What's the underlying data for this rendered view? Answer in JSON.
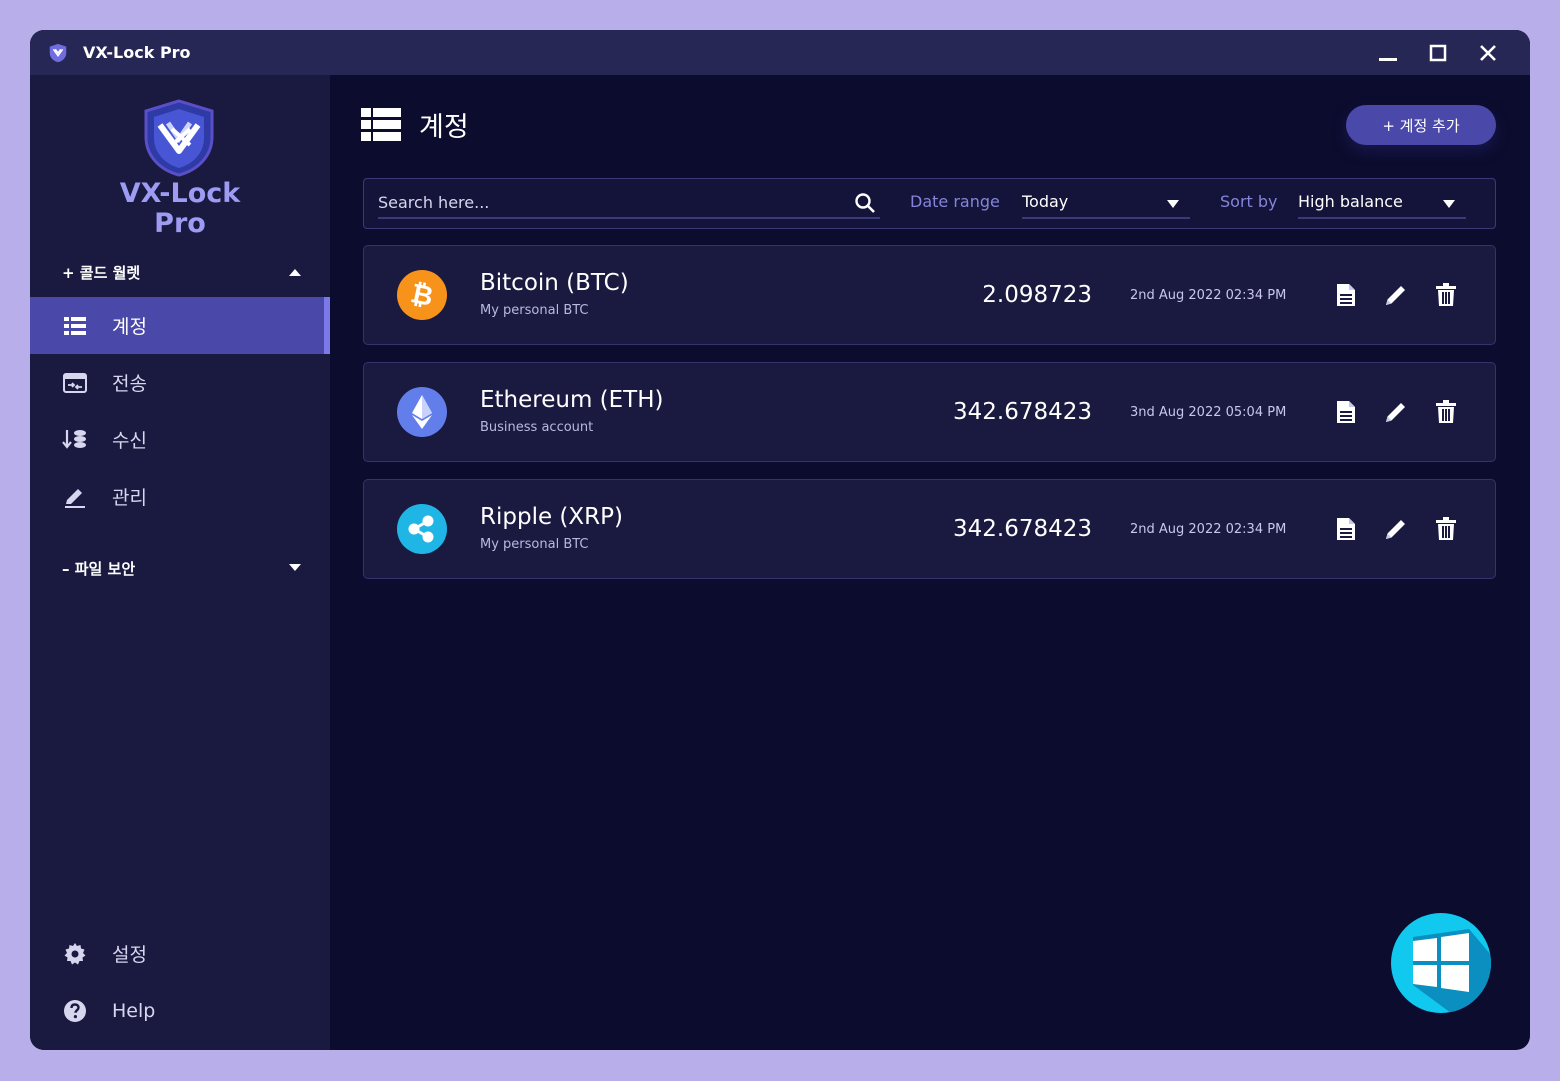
{
  "window": {
    "title": "VX-Lock Pro",
    "controls": {
      "minimize": "minimize-icon",
      "maximize": "maximize-icon",
      "close": "close-icon"
    }
  },
  "sidebar": {
    "brand_line1": "VX-Lock",
    "brand_line2": "Pro",
    "section_cold_wallet": {
      "label": "+ 콜드 월렛",
      "toggle": "caret-up-icon"
    },
    "items": [
      {
        "label": "계정",
        "icon": "list-icon",
        "active": true
      },
      {
        "label": "전송",
        "icon": "transfer-icon",
        "active": false
      },
      {
        "label": "수신",
        "icon": "receive-icon",
        "active": false
      },
      {
        "label": "관리",
        "icon": "edit-icon",
        "active": false
      }
    ],
    "section_file_security": {
      "label": "– 파일 보안",
      "toggle": "caret-down-icon"
    },
    "bottom_items": [
      {
        "label": "설정",
        "icon": "gear-icon"
      },
      {
        "label": "Help",
        "icon": "help-icon"
      }
    ]
  },
  "main": {
    "title": "계정",
    "add_button": "+ 계정 추가",
    "search": {
      "placeholder": "Search here...",
      "value": ""
    },
    "date_range": {
      "label": "Date range",
      "value": "Today"
    },
    "sort_by": {
      "label": "Sort by",
      "value": "High balance"
    },
    "accounts": [
      {
        "name": "Bitcoin (BTC)",
        "subtitle": "My personal BTC",
        "balance": "2.098723",
        "date": "2nd Aug 2022 02:34 PM",
        "icon": "bitcoin-icon",
        "color": "#f7931a"
      },
      {
        "name": "Ethereum (ETH)",
        "subtitle": "Business account",
        "balance": "342.678423",
        "date": "3nd Aug 2022 05:04 PM",
        "icon": "ethereum-icon",
        "color": "#627eea"
      },
      {
        "name": "Ripple (XRP)",
        "subtitle": "My personal BTC",
        "balance": "342.678423",
        "date": "2nd Aug 2022 02:34 PM",
        "icon": "ripple-icon",
        "color": "#1fb6e6"
      }
    ]
  },
  "colors": {
    "background": "#b8aeea",
    "window": "#0c0c2e",
    "titlebar": "#262755",
    "sidebar": "#1a1a40",
    "accent": "#4a48a8",
    "muted_label": "#8684d8"
  }
}
